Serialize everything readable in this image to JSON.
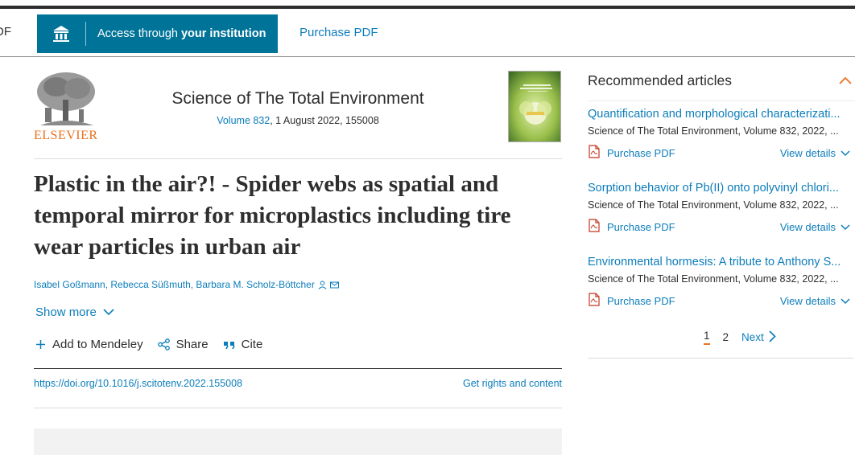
{
  "toolbar": {
    "left_stub": "DF",
    "access_prefix": "Access through ",
    "access_bold": "your institution",
    "purchase_pdf": "Purchase PDF"
  },
  "journal": {
    "publisher": "ELSEVIER",
    "title": "Science of The Total Environment",
    "volume": "Volume 832",
    "date_info": ", 1 August 2022, 155008"
  },
  "article": {
    "title": "Plastic in the air?! - Spider webs as spatial and temporal mirror for microplastics including tire wear particles in urban air",
    "authors": "Isabel Goßmann, Rebecca Süßmuth, Barbara M. Scholz-Böttcher",
    "show_more": "Show more",
    "actions": {
      "mendeley": "Add to Mendeley",
      "share": "Share",
      "cite": "Cite"
    },
    "doi": "https://doi.org/10.1016/j.scitotenv.2022.155008",
    "rights": "Get rights and content"
  },
  "sidebar": {
    "heading": "Recommended articles",
    "items": [
      {
        "title": "Quantification and morphological characterizati...",
        "source": "Science of The Total Environment, Volume 832, 2022, ...",
        "pdf": "Purchase PDF",
        "details": "View details"
      },
      {
        "title": "Sorption behavior of Pb(II) onto polyvinyl chlori...",
        "source": "Science of The Total Environment, Volume 832, 2022, ...",
        "pdf": "Purchase PDF",
        "details": "View details"
      },
      {
        "title": "Environmental hormesis: A tribute to Anthony S...",
        "source": "Science of The Total Environment, Volume 832, 2022, ...",
        "pdf": "Purchase PDF",
        "details": "View details"
      }
    ],
    "pager": {
      "page1": "1",
      "page2": "2",
      "next": "Next"
    }
  },
  "colors": {
    "brand_blue": "#007398",
    "link": "#0c7dbb",
    "accent_orange": "#e9711c"
  },
  "icons": [
    "institution-icon",
    "elsevier-tree-logo",
    "journal-cover",
    "person-icon",
    "envelope-icon",
    "chevron-down-icon",
    "plus-icon",
    "share-icon",
    "quote-icon",
    "chevron-up-icon",
    "pdf-icon",
    "chevron-right-icon"
  ]
}
